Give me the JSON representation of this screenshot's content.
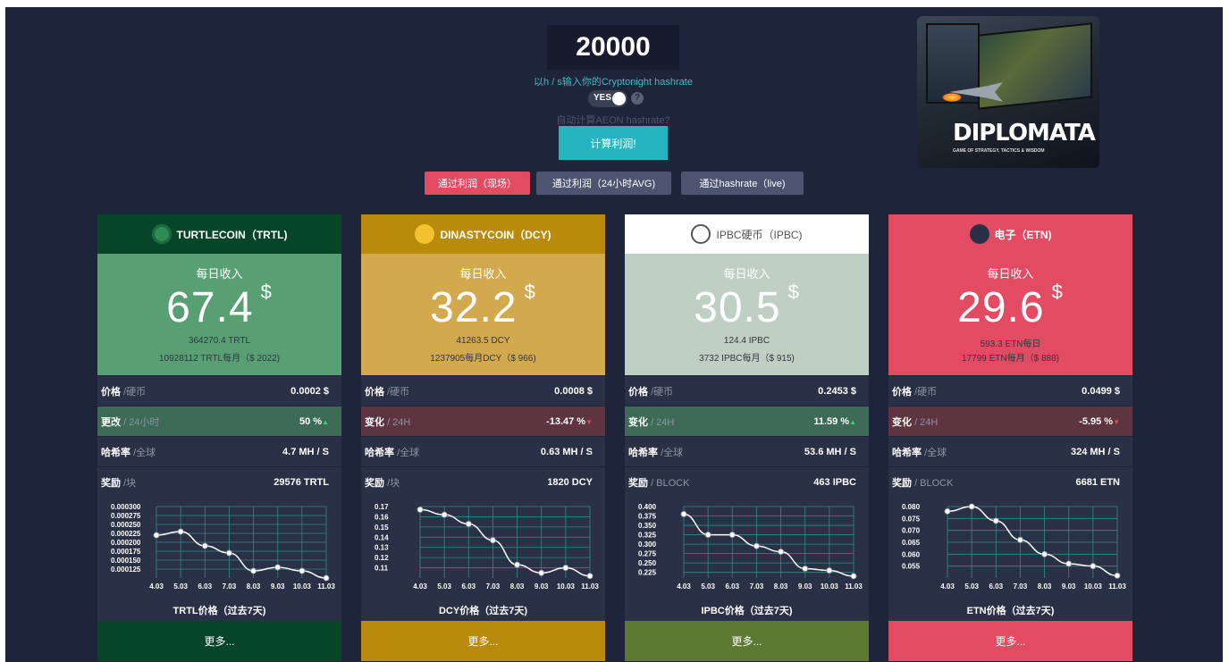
{
  "header": {
    "hashrate_value": "20000",
    "hashrate_hint": "以h / s输入你的Cryptonight hashrate",
    "toggle_label": "YES",
    "help_icon": "?",
    "auto_note": "自动计算AEON hashrate?",
    "calc_button": "计算利润!",
    "modes": [
      "通过利润（现场）",
      "通过利润（24小时AVG)",
      "通过hashrate（live)"
    ]
  },
  "ad": {
    "title": "DIPLOMATA",
    "subtitle": "GAME OF STRATEGY, TACTICS & WISDOM"
  },
  "colors": {
    "trtl": "#58a074",
    "dcy": "#d3a94e",
    "ipbc": "#bfd0c2",
    "etn": "#e34b63"
  },
  "cards": [
    {
      "head": "TURTLECOIN（TRTL)",
      "daily_label": "每日收入",
      "daily_value": "67.4",
      "dollar": "$",
      "line1": "364270.4 TRTL",
      "line2": "10928112 TRTL每月（$ 2022)",
      "price_k": "价格",
      "price_u": "/硬币",
      "price_v": "0.0002 $",
      "change_k": "更改",
      "change_u": "/ 24小时",
      "change_v": "50 %",
      "hash_k": "哈希率",
      "hash_u": "/全球",
      "hash_v": "4.7 MH / S",
      "reward_k": "奖励",
      "reward_u": "/块",
      "reward_v": "29576 TRTL",
      "chart_caption": "TRTL价格（过去7天)",
      "more": "更多..."
    },
    {
      "head": "DINASTYCOIN（DCY)",
      "daily_label": "每日收入",
      "daily_value": "32.2",
      "dollar": "$",
      "line1": "41263.5 DCY",
      "line2": "1237905每月DCY（$ 966)",
      "price_k": "价格",
      "price_u": "/硬币",
      "price_v": "0.0008 $",
      "change_k": "变化",
      "change_u": "/ 24H",
      "change_v": "-13.47 %",
      "hash_k": "哈希率",
      "hash_u": "/全球",
      "hash_v": "0.63 MH / S",
      "reward_k": "奖励",
      "reward_u": "/块",
      "reward_v": "1820 DCY",
      "chart_caption": "DCY价格（过去7天)",
      "more": "更多..."
    },
    {
      "head": "IPBC硬币（IPBC)",
      "daily_label": "每日收入",
      "daily_value": "30.5",
      "dollar": "$",
      "line1": "124.4 IPBC",
      "line2": "3732 IPBC每月（$ 915)",
      "price_k": "价格",
      "price_u": "/硬币",
      "price_v": "0.2453 $",
      "change_k": "变化",
      "change_u": "/ 24H",
      "change_v": "11.59 %",
      "hash_k": "哈希率",
      "hash_u": "/全球",
      "hash_v": "53.6 MH / S",
      "reward_k": "奖励",
      "reward_u": "/ BLOCK",
      "reward_v": "463 IPBC",
      "chart_caption": "IPBC价格（过去7天)",
      "more": "更多..."
    },
    {
      "head": "电子（ETN)",
      "daily_label": "每日收入",
      "daily_value": "29.6",
      "dollar": "$",
      "line1": "593.3 ETN每日",
      "line2": "17799 ETN每月（$ 888)",
      "price_k": "价格",
      "price_u": "/硬币",
      "price_v": "0.0499 $",
      "change_k": "变化",
      "change_u": "/ 24H",
      "change_v": "-5.95 %",
      "hash_k": "哈希率",
      "hash_u": "/全球",
      "hash_v": "324 MH / S",
      "reward_k": "奖励",
      "reward_u": "/ BLOCK",
      "reward_v": "6681 ETN",
      "chart_caption": "ETN价格（过去7天)",
      "more": "更多..."
    }
  ],
  "chart_data": [
    {
      "type": "line",
      "x": [
        "4.03",
        "5.03",
        "6.03",
        "7.03",
        "8.03",
        "9.03",
        "10.03",
        "11.03"
      ],
      "values": [
        0.00022,
        0.00023,
        0.00019,
        0.00017,
        0.00012,
        0.00013,
        0.00012,
        0.0001
      ],
      "ylim": [
        0.0001,
        0.0003
      ],
      "yticks": [
        "0.000300",
        "0.000275",
        "0.000250",
        "0.000225",
        "0.000200",
        "0.000175",
        "0.000150",
        "0.000125"
      ],
      "xlabel": "TRTL价格（过去7天)"
    },
    {
      "type": "line",
      "x": [
        "4.03",
        "5.03",
        "6.03",
        "7.03",
        "8.03",
        "9.03",
        "10.03",
        "11.03"
      ],
      "values": [
        0.167,
        0.162,
        0.153,
        0.137,
        0.113,
        0.105,
        0.11,
        0.102
      ],
      "ylim": [
        0.1,
        0.17
      ],
      "yticks": [
        "0.17",
        "0.16",
        "0.15",
        "0.14",
        "0.13",
        "0.12",
        "0.11"
      ],
      "xlabel": "DCY价格（过去7天)"
    },
    {
      "type": "line",
      "x": [
        "4.03",
        "5.03",
        "6.03",
        "7.03",
        "8.03",
        "9.03",
        "10.03",
        "11.03"
      ],
      "values": [
        0.38,
        0.325,
        0.325,
        0.295,
        0.28,
        0.235,
        0.23,
        0.215
      ],
      "ylim": [
        0.21,
        0.4
      ],
      "yticks": [
        "0.400",
        "0.375",
        "0.350",
        "0.325",
        "0.300",
        "0.275",
        "0.250",
        "0.225"
      ],
      "xlabel": "IPBC价格（过去7天)"
    },
    {
      "type": "line",
      "x": [
        "4.03",
        "5.03",
        "6.03",
        "7.03",
        "8.03",
        "9.03",
        "10.03",
        "11.03"
      ],
      "values": [
        0.078,
        0.08,
        0.074,
        0.066,
        0.06,
        0.056,
        0.055,
        0.051
      ],
      "ylim": [
        0.05,
        0.08
      ],
      "yticks": [
        "0.080",
        "0.075",
        "0.070",
        "0.065",
        "0.060",
        "0.055"
      ],
      "xlabel": "ETN价格（过去7天)"
    }
  ]
}
